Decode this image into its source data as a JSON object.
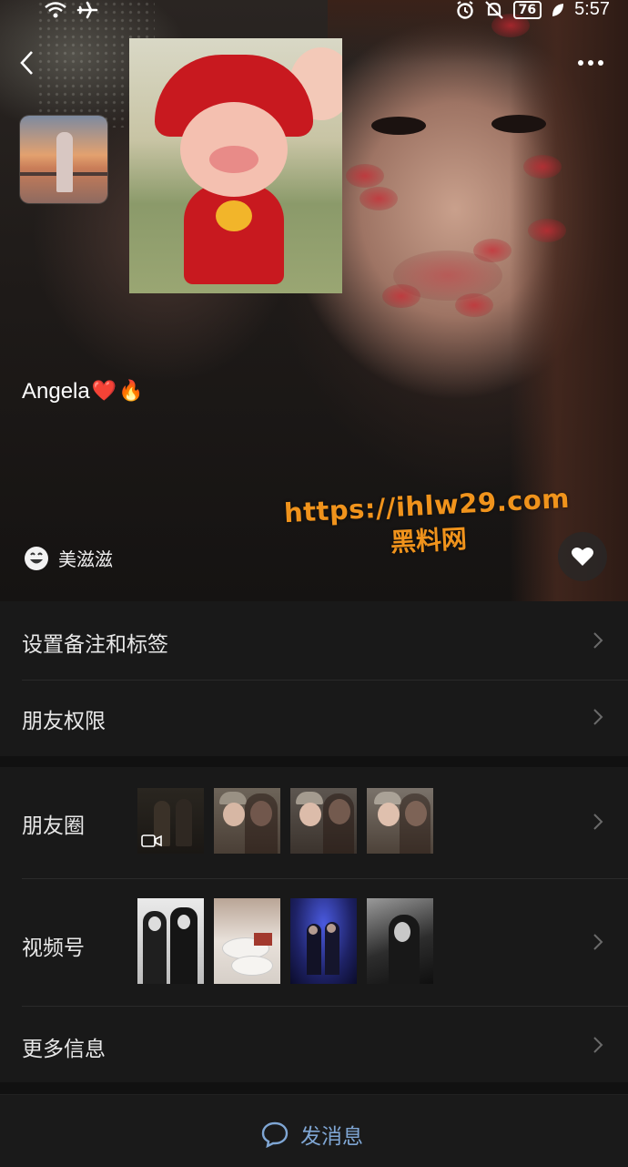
{
  "status_bar": {
    "battery": "76",
    "time": "5:57",
    "icons": [
      "wifi-icon",
      "airplane-icon",
      "alarm-icon",
      "mute-icon",
      "battery-icon",
      "leaf-icon"
    ]
  },
  "profile": {
    "name": "Angela",
    "name_emojis": [
      "❤️",
      "🔥"
    ],
    "status_label": "美滋滋",
    "status_icon": "smile-face-icon"
  },
  "watermark": {
    "url": "https://ihlw29.com",
    "site": "黑料网",
    "color": "#f0931c"
  },
  "menu": {
    "remark_label": "设置备注和标签",
    "permissions_label": "朋友权限",
    "moments_label": "朋友圈",
    "channels_label": "视频号",
    "more_info_label": "更多信息"
  },
  "bottom": {
    "send_message_label": "发消息",
    "accent_color": "#7fa6d4"
  }
}
